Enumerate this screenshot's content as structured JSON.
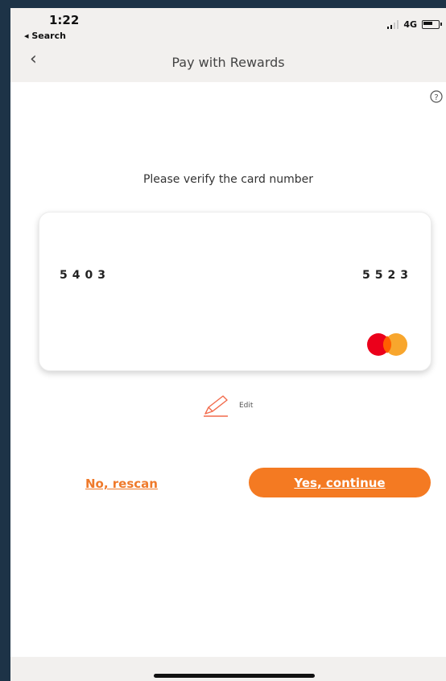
{
  "status_bar": {
    "time": "1:22",
    "back_app": "◂ Search",
    "network": "4G"
  },
  "header": {
    "title": "Pay with Rewards",
    "back_icon": "chevron-left-icon",
    "help_icon": "question-circle-icon"
  },
  "main": {
    "instruction": "Please verify the card number",
    "card": {
      "first_digits": "5403",
      "last_digits": "5523",
      "brand_icon": "mastercard-logo"
    },
    "edit_label": "Edit",
    "rescan_label": "No, rescan",
    "continue_label": "Yes, continue"
  },
  "colors": {
    "accent": "#f47a22",
    "mastercard_red": "#eb001b",
    "mastercard_orange": "#f79e1b"
  }
}
